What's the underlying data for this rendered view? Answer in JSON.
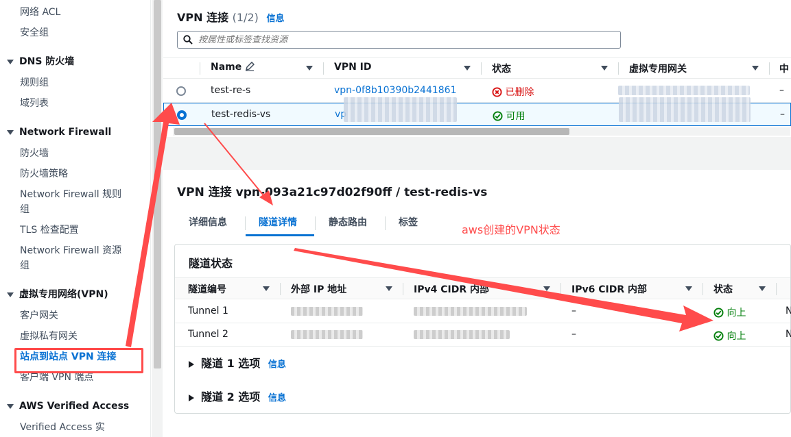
{
  "sidebar": {
    "items": [
      {
        "label": "网络 ACL"
      },
      {
        "label": "安全组"
      },
      {
        "label": "规则组"
      },
      {
        "label": "域列表"
      },
      {
        "label": "防火墙"
      },
      {
        "label": "防火墙策略"
      },
      {
        "label": "Network Firewall 规则"
      },
      {
        "label": "组"
      },
      {
        "label": "TLS 检查配置"
      },
      {
        "label": "Network Firewall 资源"
      },
      {
        "label": "组"
      },
      {
        "label": "客户网关"
      },
      {
        "label": "虚拟私有网关"
      },
      {
        "label": "站点到站点 VPN 连接"
      },
      {
        "label": "客户端 VPN 端点"
      },
      {
        "label": "Verified Access 实"
      }
    ],
    "sections": [
      {
        "label": "DNS 防火墙"
      },
      {
        "label": "Network Firewall"
      },
      {
        "label": "虚拟专用网络(VPN)"
      },
      {
        "label": "AWS Verified Access"
      }
    ]
  },
  "list": {
    "title": "VPN 连接",
    "count": "(1/2)",
    "info": "信息",
    "search_placeholder": "按属性或标签查找资源",
    "columns": [
      "Name",
      "VPN ID",
      "状态",
      "虚拟专用网关",
      "中"
    ],
    "rows": [
      {
        "name": "test-re-s",
        "vpn_id": "vpn-0f8b10390b2441861",
        "status": "已删除",
        "last": "–"
      },
      {
        "name": "test-redis-vs",
        "vpn_id": "vp",
        "status": "可用",
        "last": "–"
      }
    ]
  },
  "detail": {
    "title": "VPN 连接 vpn-093a21c97d02f90ff / test-redis-vs",
    "tabs": [
      "详细信息",
      "隧道详情",
      "静态路由",
      "标签"
    ],
    "annotation": "aws创建的VPN状态",
    "tunnel_state_title": "隧道状态",
    "columns": [
      "隧道编号",
      "外部 IP 地址",
      "IPv4 CIDR 内部",
      "IPv6 CIDR 内部",
      "状态"
    ],
    "rows": [
      {
        "tunnel": "Tunnel 1",
        "ipv6": "–",
        "status": "向上",
        "last": "N"
      },
      {
        "tunnel": "Tunnel 2",
        "ipv6": "–",
        "status": "向上",
        "last": "N"
      }
    ],
    "options": [
      {
        "label": "隧道 1 选项",
        "info": "信息"
      },
      {
        "label": "隧道 2 选项",
        "info": "信息"
      }
    ]
  },
  "colors": {
    "accent": "#0972d3",
    "annotation": "#ff4b4b",
    "success": "#037f0c",
    "error": "#d91515"
  }
}
